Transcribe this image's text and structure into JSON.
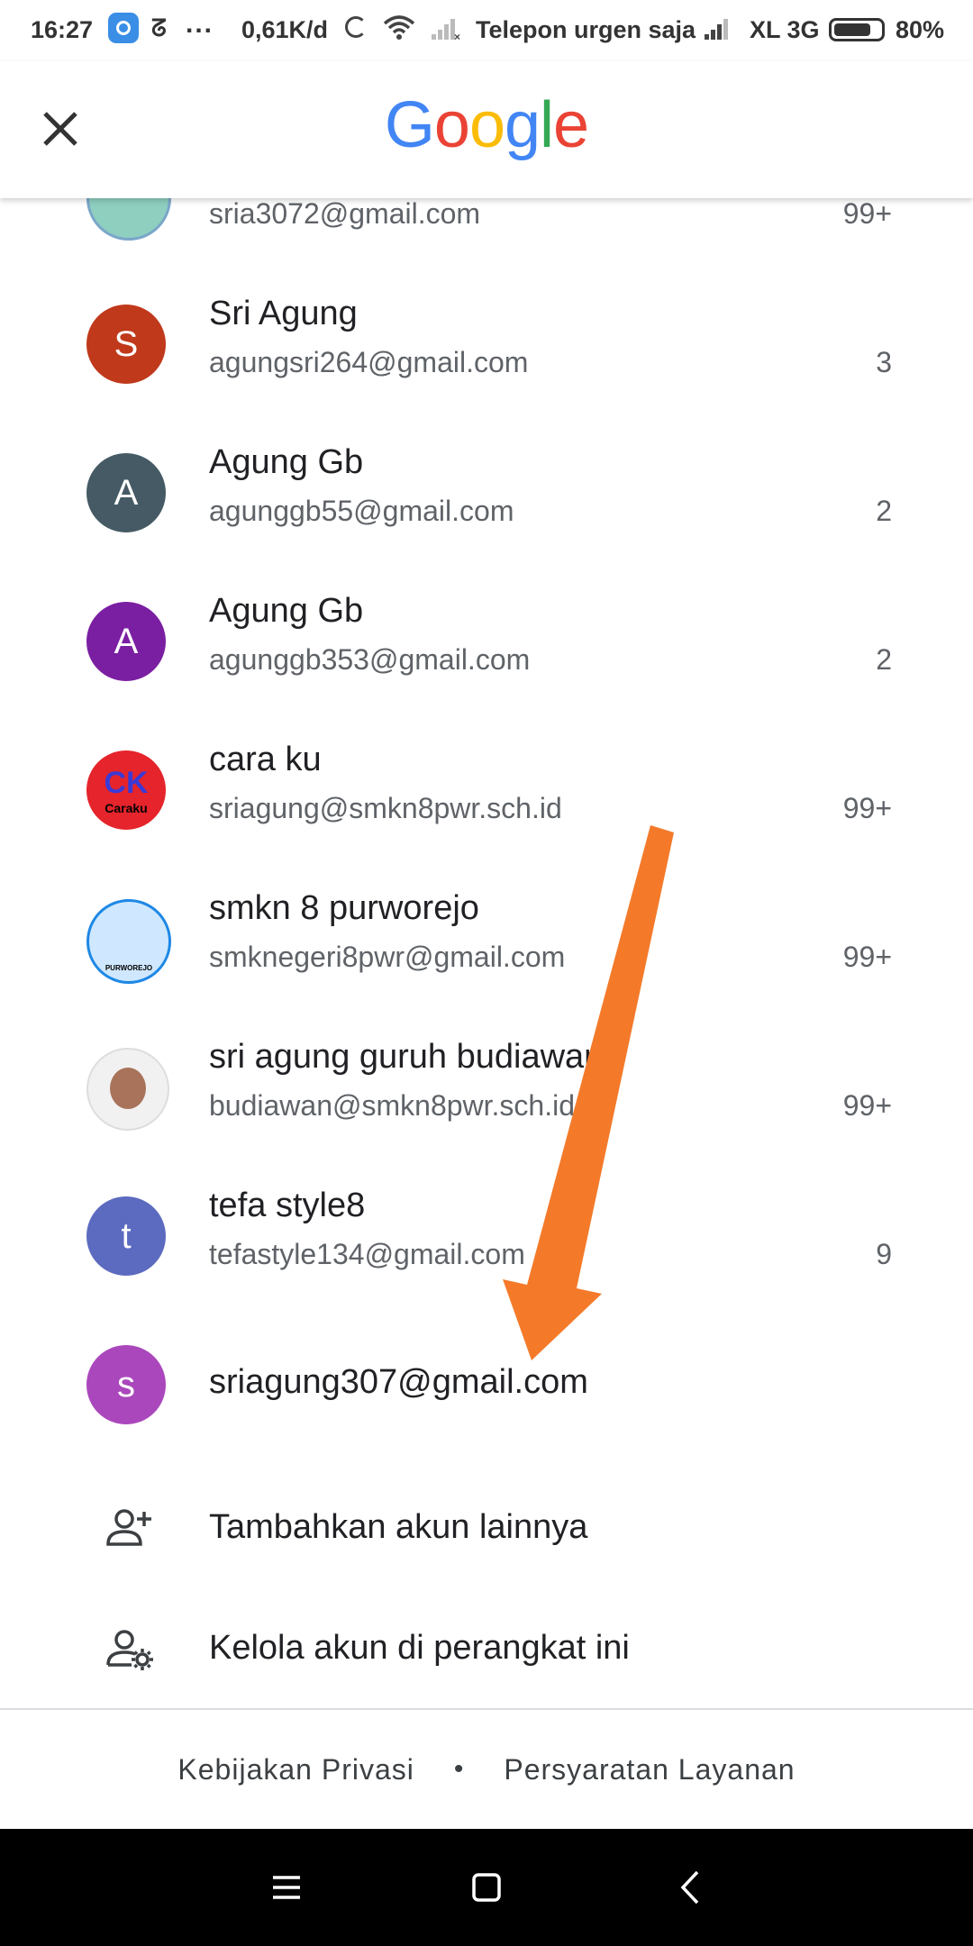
{
  "status_bar": {
    "time": "16:27",
    "zeta": "ᘔ",
    "dots": "...",
    "speed": "0,61K/d",
    "carrier1": "Telepon urgen saja",
    "carrier2": "XL 3G",
    "battery_pct": "80%",
    "battery_level": 0.8
  },
  "header": {
    "close_icon": "close-icon",
    "logo_letters": [
      "G",
      "o",
      "o",
      "g",
      "l",
      "e"
    ],
    "logo_colors": [
      "#4285F4",
      "#EA4335",
      "#FBBC05",
      "#4285F4",
      "#34A853",
      "#EA4335"
    ]
  },
  "accounts": [
    {
      "name": "",
      "email": "sria3072@gmail.com",
      "count": "99+",
      "avatar_initial": "",
      "avatar_color": "#8ecfc0"
    },
    {
      "name": "Sri Agung",
      "email": "agungsri264@gmail.com",
      "count": "3",
      "avatar_initial": "S",
      "avatar_color": "#c0391b"
    },
    {
      "name": "Agung Gb",
      "email": "agunggb55@gmail.com",
      "count": "2",
      "avatar_initial": "A",
      "avatar_color": "#455a64"
    },
    {
      "name": "Agung Gb",
      "email": "agunggb353@gmail.com",
      "count": "2",
      "avatar_initial": "A",
      "avatar_color": "#7b1fa2"
    },
    {
      "name": "cara ku",
      "email": "sriagung@smkn8pwr.sch.id",
      "count": "99+",
      "avatar_initial": "CK",
      "avatar_caption": "Caraku",
      "avatar_color": "#e5242b"
    },
    {
      "name": "smkn 8 purworejo",
      "email": "smknegeri8pwr@gmail.com",
      "count": "99+",
      "avatar_initial": "",
      "avatar_caption": "PURWOREJO",
      "avatar_color": "#1e88e5"
    },
    {
      "name": "sri agung guruh budiawan",
      "email": "budiawan@smkn8pwr.sch.id",
      "count": "99+",
      "avatar_initial": "",
      "avatar_color": "#f1f1f1"
    },
    {
      "name": "tefa style8",
      "email": "tefastyle134@gmail.com",
      "count": "9",
      "avatar_initial": "t",
      "avatar_color": "#5c6bc0"
    },
    {
      "name": "",
      "email": "sriagung307@gmail.com",
      "count": "",
      "avatar_initial": "s",
      "avatar_color": "#ab47bc"
    }
  ],
  "actions": {
    "add_account": "Tambahkan akun lainnya",
    "manage_accounts": "Kelola akun di perangkat ini"
  },
  "footer": {
    "privacy": "Kebijakan Privasi",
    "separator": "•",
    "terms": "Persyaratan Layanan"
  },
  "annotation": {
    "arrow_color": "#f47a2a"
  }
}
